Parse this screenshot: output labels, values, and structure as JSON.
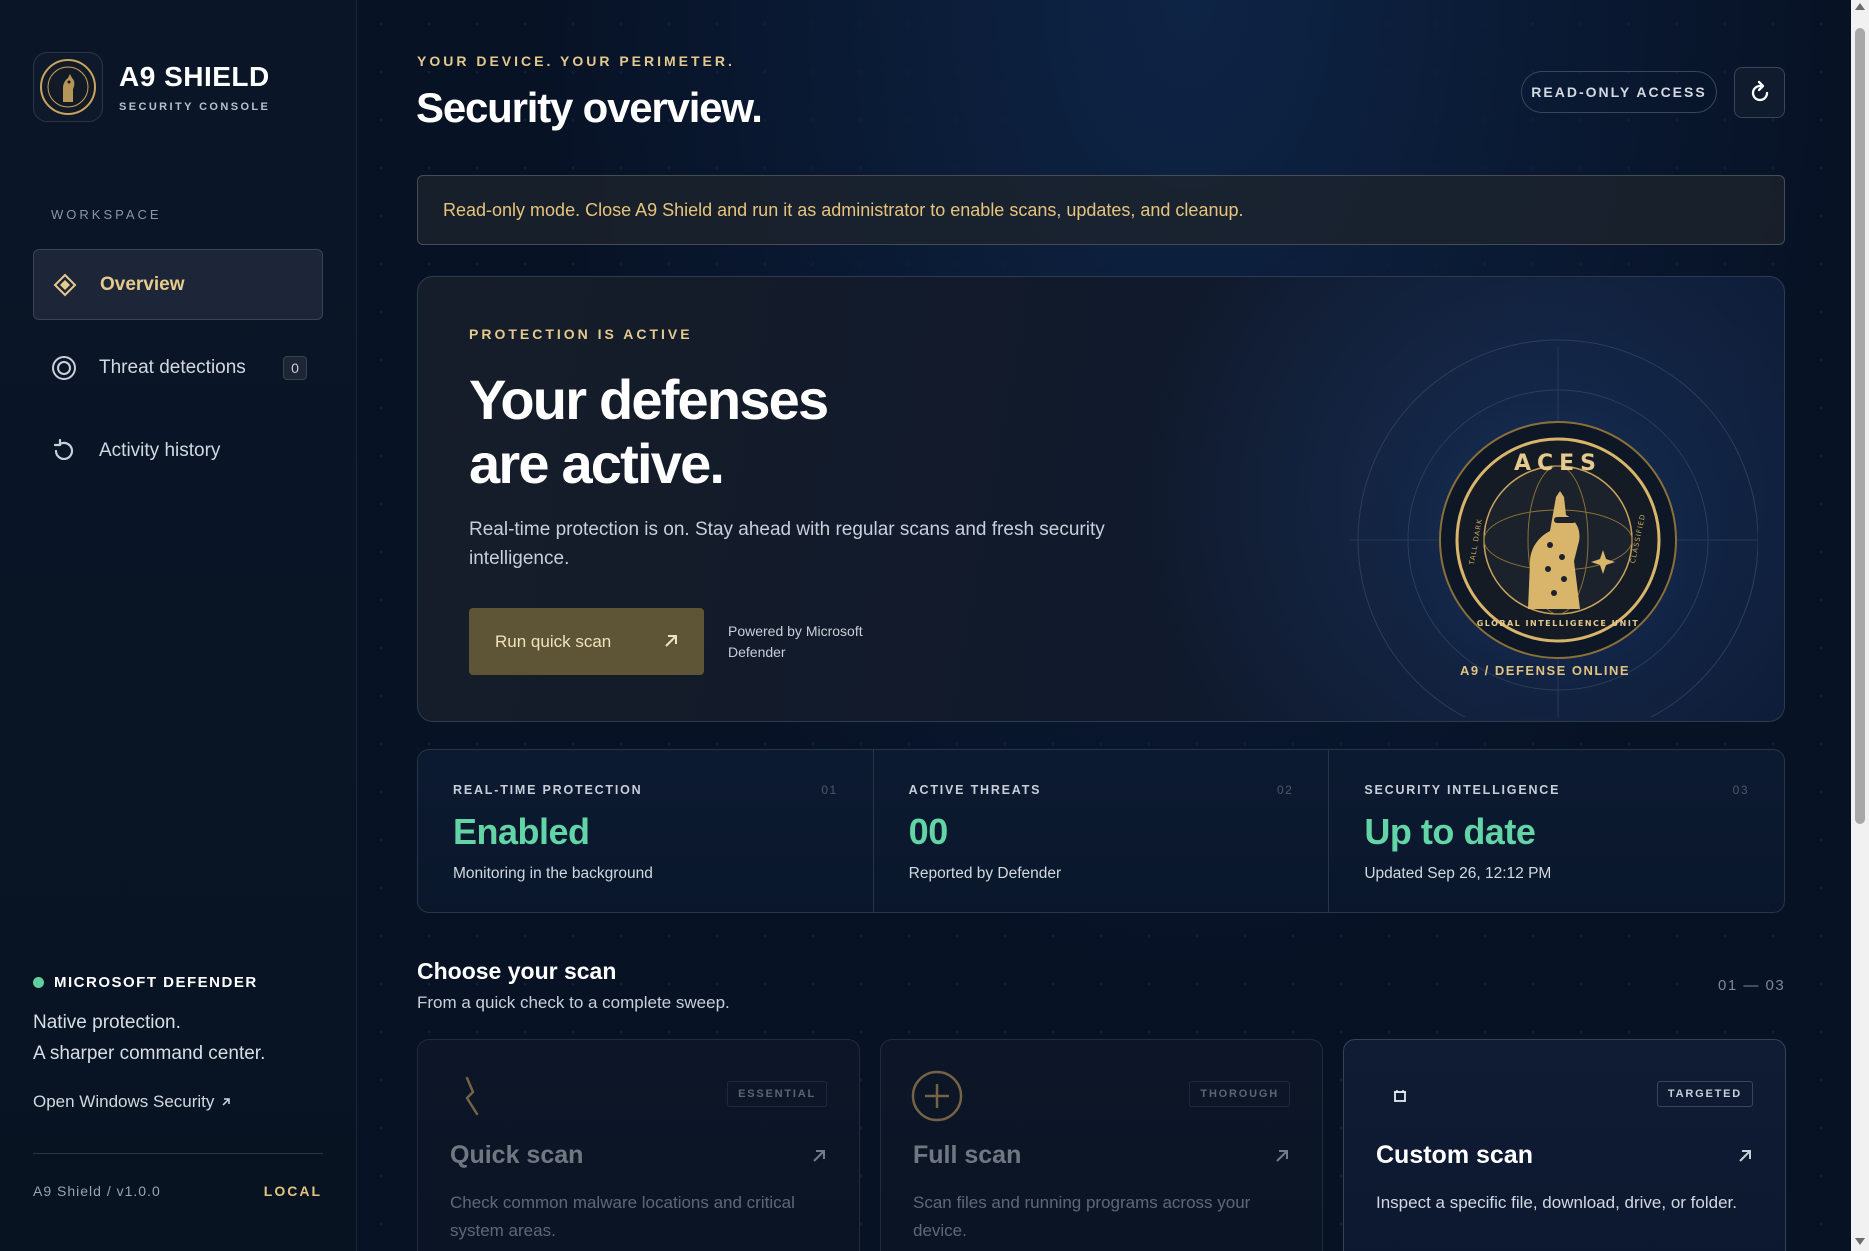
{
  "brand": {
    "name": "A9 SHIELD",
    "subtitle": "SECURITY CONSOLE",
    "logo_icon": "giraffe-emblem-icon"
  },
  "sidebar": {
    "section_label": "WORKSPACE",
    "items": [
      {
        "label": "Overview",
        "icon": "diamond-icon",
        "active": true
      },
      {
        "label": "Threat detections",
        "icon": "target-icon",
        "badge": "0"
      },
      {
        "label": "Activity history",
        "icon": "history-icon"
      }
    ],
    "defender": {
      "status_title": "MICROSOFT DEFENDER",
      "status_color": "#5fcf9e",
      "line1": "Native protection.",
      "line2": "A sharper command center.",
      "link": "Open Windows Security"
    },
    "version": "A9 Shield / v1.0.0",
    "mode": "LOCAL"
  },
  "header": {
    "eyebrow": "YOUR DEVICE. YOUR PERIMETER.",
    "title": "Security overview.",
    "access_label": "READ-ONLY ACCESS",
    "refresh_icon": "refresh-icon"
  },
  "notice": {
    "text": "Read-only mode. Close A9 Shield and run it as administrator to enable scans, updates, and cleanup."
  },
  "hero": {
    "eyebrow": "PROTECTION IS ACTIVE",
    "title_line1": "Your defenses",
    "title_line2": "are active.",
    "description": "Real-time protection is on. Stay ahead with regular scans and fresh security intelligence.",
    "button_label": "Run quick scan",
    "powered_by": "Powered by Microsoft Defender",
    "emblem_text_top": "ACES",
    "emblem_text_bottom": "GLOBAL INTELLIGENCE UNIT",
    "emblem_text_left": "TALL DARK",
    "emblem_text_right": "CLASSIFIED",
    "emblem_caption": "A9 / DEFENSE ONLINE"
  },
  "stats": [
    {
      "label": "REAL-TIME PROTECTION",
      "index": "01",
      "value": "Enabled",
      "sub": "Monitoring in the background"
    },
    {
      "label": "ACTIVE THREATS",
      "index": "02",
      "value": "00",
      "sub": "Reported by Defender"
    },
    {
      "label": "SECURITY INTELLIGENCE",
      "index": "03",
      "value": "Up to date",
      "sub": "Updated Sep 26, 12:12 PM"
    }
  ],
  "scans": {
    "title": "Choose your scan",
    "subtitle": "From a quick check to a complete sweep.",
    "range": "01 — 03",
    "cards": [
      {
        "tag": "ESSENTIAL",
        "title": "Quick scan",
        "description": "Check common malware locations and critical system areas.",
        "icon": "lightning-icon"
      },
      {
        "tag": "THOROUGH",
        "title": "Full scan",
        "description": "Scan files and running programs across your device.",
        "icon": "plus-circle-icon"
      },
      {
        "tag": "TARGETED",
        "title": "Custom scan",
        "description": "Inspect a specific file, download, drive, or folder.",
        "icon": "crosshair-icon"
      }
    ]
  },
  "colors": {
    "accent_gold": "#e4c98d",
    "status_green": "#62d4a6",
    "background": "#071225"
  }
}
